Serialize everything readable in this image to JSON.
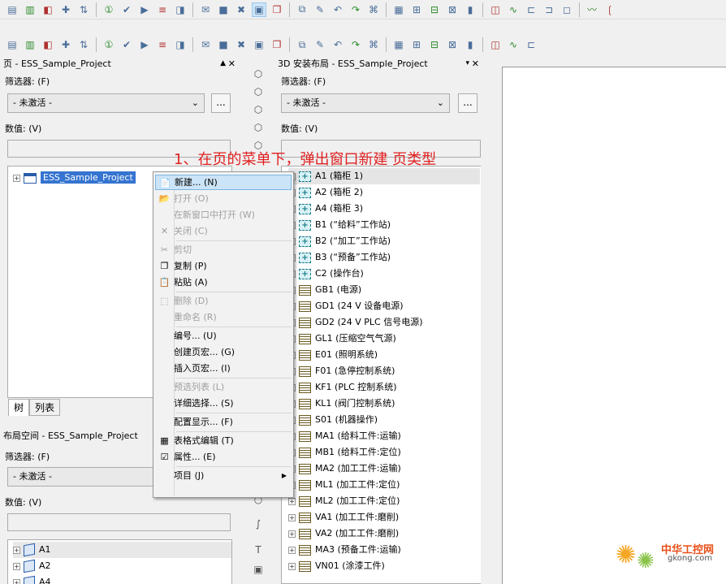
{
  "toolbar1": {
    "icons": [
      "page-new-icon",
      "page-open-icon",
      "plugin-icon",
      "numbering-icon",
      "sort-icon",
      "numbers-icon",
      "check-icon",
      "check-run-icon",
      "check-list-icon",
      "check-page-icon",
      "check-message-icon",
      "check-stop-icon",
      "check-delete-icon",
      "page-window-icon",
      "page-copy-icon",
      "page-link-icon",
      "page-edit-icon",
      "page-back-icon",
      "page-forward-icon",
      "macro-icon",
      "grid-icon",
      "symbol-a-icon",
      "symbol-b-icon",
      "symbol-c-icon",
      "terminal-icon",
      "plc-icon",
      "cable-icon",
      "connector-icon",
      "device-icon",
      "box-icon",
      "wave-icon",
      "bracket-icon"
    ]
  },
  "toolbar2": {
    "icons": [
      "connector-h-icon",
      "wire-icon",
      "busbar-icon",
      "terminal-strip-icon",
      "eraser-icon",
      "table-icon",
      "frame-icon",
      "switch-icon",
      "plug-icon",
      "omega-icon",
      "line-icon",
      "dash-icon",
      "arrow-icon",
      "interrupt-icon",
      "link-icon",
      "stack-icon",
      "pin-icon",
      "assign-icon",
      "path-a-icon",
      "path-b-icon",
      "path-c-icon",
      "path-d-icon",
      "path-e-icon",
      "path-f-icon",
      "path-g-icon",
      "rule-icon",
      "rule2-icon",
      "scale-icon"
    ]
  },
  "pages_panel": {
    "title": "页 - ESS_Sample_Project",
    "filter_label": "筛选器: (F)",
    "filter_value": "- 未激活 -",
    "dots": "...",
    "value_label": "数值: (V)",
    "root_label": "ESS_Sample_Project",
    "tabs": [
      "树",
      "列表"
    ]
  },
  "layout_panel": {
    "title": "布局空间 - ESS_Sample_Project",
    "filter_label": "筛选器: (F)",
    "filter_value": "- 未激活 -",
    "value_label": "数值: (V)",
    "items": [
      "A1",
      "A2",
      "A4"
    ]
  },
  "install_panel": {
    "title": "3D 安装布局 - ESS_Sample_Project",
    "filter_label": "筛选器: (F)",
    "filter_value": "- 未激活 -",
    "dots": "...",
    "value_label": "数值: (V)",
    "items": [
      {
        "label": "A1 (箱柜 1)",
        "kind": "cab"
      },
      {
        "label": "A2 (箱柜 2)",
        "kind": "cab"
      },
      {
        "label": "A4 (箱柜 3)",
        "kind": "cab"
      },
      {
        "label": "B1 (“给料”工作站)",
        "kind": "cab"
      },
      {
        "label": "B2 (“加工”工作站)",
        "kind": "cab"
      },
      {
        "label": "B3 (“预备”工作站)",
        "kind": "cab"
      },
      {
        "label": "C2 (操作台)",
        "kind": "cab"
      },
      {
        "label": "GB1 (电源)",
        "kind": "grp"
      },
      {
        "label": "GD1 (24 V 设备电源)",
        "kind": "grp"
      },
      {
        "label": "GD2 (24 V PLC 信号电源)",
        "kind": "grp"
      },
      {
        "label": "GL1 (压缩空气气源)",
        "kind": "grp"
      },
      {
        "label": "E01 (照明系统)",
        "kind": "grp"
      },
      {
        "label": "F01 (急停控制系统)",
        "kind": "grp"
      },
      {
        "label": "KF1 (PLC 控制系统)",
        "kind": "grp"
      },
      {
        "label": "KL1 (阀门控制系统)",
        "kind": "grp"
      },
      {
        "label": "S01 (机器操作)",
        "kind": "grp"
      },
      {
        "label": "MA1 (给料工件:运输)",
        "kind": "grp"
      },
      {
        "label": "MB1 (给料工件:定位)",
        "kind": "grp"
      },
      {
        "label": "MA2 (加工工件:运输)",
        "kind": "grp"
      },
      {
        "label": "ML1 (加工工件:定位)",
        "kind": "grp"
      },
      {
        "label": "ML2 (加工工件:定位)",
        "kind": "grp"
      },
      {
        "label": "VA1 (加工工件:磨削)",
        "kind": "grp"
      },
      {
        "label": "VA2 (加工工件:磨削)",
        "kind": "grp"
      },
      {
        "label": "MA3 (预备工件:运输)",
        "kind": "grp"
      },
      {
        "label": "VN01 (涂漆工件)",
        "kind": "grp"
      }
    ]
  },
  "annotation": "1、在页的菜单下，弹出窗口新建 页类型",
  "context_menu": {
    "items": [
      {
        "label": "新建... (N)",
        "icon": "new-page-icon",
        "disabled": false,
        "highlight": true
      },
      {
        "label": "打开 (O)",
        "icon": "open-icon",
        "disabled": true
      },
      {
        "label": "在新窗口中打开 (W)",
        "icon": "",
        "disabled": true
      },
      {
        "label": "关闭 (C)",
        "icon": "close-page-icon",
        "disabled": true
      },
      {
        "sep": true
      },
      {
        "label": "剪切",
        "icon": "cut-icon",
        "disabled": true
      },
      {
        "label": "复制 (P)",
        "icon": "copy-icon",
        "disabled": false
      },
      {
        "label": "粘贴 (A)",
        "icon": "paste-icon",
        "disabled": false
      },
      {
        "sep": true
      },
      {
        "label": "删除 (D)",
        "icon": "delete-icon",
        "disabled": true
      },
      {
        "label": "重命名 (R)",
        "icon": "",
        "disabled": true
      },
      {
        "sep": true
      },
      {
        "label": "编号... (U)",
        "icon": "",
        "disabled": false
      },
      {
        "label": "创建页宏... (G)",
        "icon": "",
        "disabled": false
      },
      {
        "label": "插入页宏... (I)",
        "icon": "",
        "disabled": false
      },
      {
        "sep": true
      },
      {
        "label": "预选列表 (L)",
        "icon": "",
        "disabled": true
      },
      {
        "label": "详细选择... (S)",
        "icon": "",
        "disabled": false
      },
      {
        "sep": true
      },
      {
        "label": "配置显示... (F)",
        "icon": "",
        "disabled": false
      },
      {
        "sep": true
      },
      {
        "label": "表格式编辑 (T)",
        "icon": "table-edit-icon",
        "disabled": false
      },
      {
        "label": "属性... (E)",
        "icon": "properties-icon",
        "disabled": false
      },
      {
        "sep": true
      },
      {
        "label": "项目 (J)",
        "icon": "",
        "disabled": false,
        "submenu": true
      }
    ]
  },
  "watermark": {
    "brand": "中华工控网",
    "url": "gkong.com"
  }
}
